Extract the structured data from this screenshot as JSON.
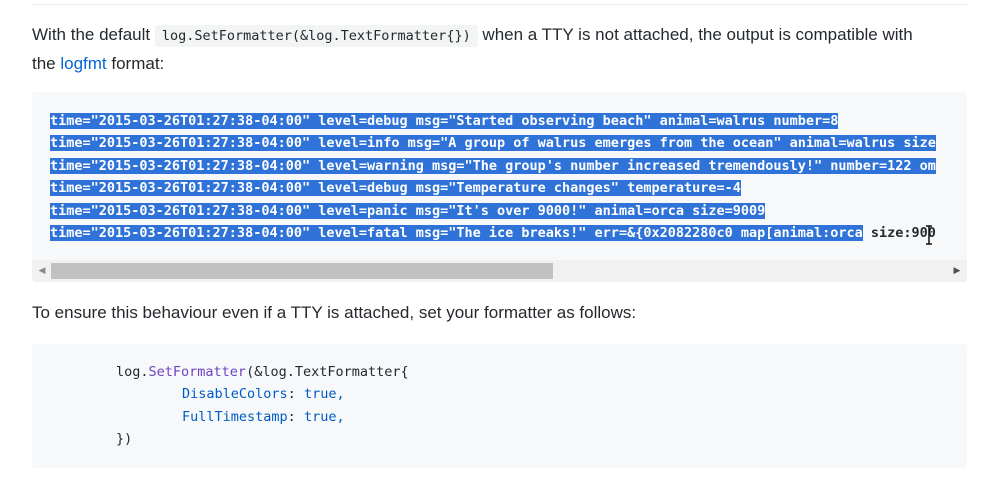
{
  "paragraph_1": {
    "before_code": "With the default ",
    "inline_code": "log.SetFormatter(&log.TextFormatter{})",
    "after_code": " when a TTY is not attached, the output is compatible with",
    "line2_before_link": "the ",
    "link_text": "logfmt",
    "line2_after_link": " format:"
  },
  "log_output": {
    "lines": [
      {
        "selected": "time=\"2015-03-26T01:27:38-04:00\" level=debug msg=\"Started observing beach\" animal=walrus number=8",
        "rest": ""
      },
      {
        "selected": "time=\"2015-03-26T01:27:38-04:00\" level=info msg=\"A group of walrus emerges from the ocean\" animal=walrus size",
        "rest": ""
      },
      {
        "selected": "time=\"2015-03-26T01:27:38-04:00\" level=warning msg=\"The group's number increased tremendously!\" number=122 om",
        "rest": ""
      },
      {
        "selected": "time=\"2015-03-26T01:27:38-04:00\" level=debug msg=\"Temperature changes\" temperature=-4",
        "rest": ""
      },
      {
        "selected": "time=\"2015-03-26T01:27:38-04:00\" level=panic msg=\"It's over 9000!\" animal=orca size=9009",
        "rest": ""
      },
      {
        "selected": "time=\"2015-03-26T01:27:38-04:00\" level=fatal msg=\"The ice breaks!\" err=&{0x2082280c0 map[animal:orca",
        "rest": " size:900"
      }
    ],
    "scrollbar": {
      "left_arrow": "◀",
      "right_arrow": "▶"
    }
  },
  "paragraph_2": {
    "text": "To ensure this behaviour even if a TTY is attached, set your formatter as follows:"
  },
  "code_example": {
    "line1_obj": "log.",
    "line1_fn": "SetFormatter",
    "line1_rest": "(&log.TextFormatter{",
    "line2_field": "DisableColors",
    "line2_colon": ":",
    "line2_value": " true,",
    "line3_field": "FullTimestamp",
    "line3_colon": ":",
    "line3_value": " true,",
    "line4": "})"
  },
  "colors": {
    "selection": "#2f73d8",
    "link": "#0366d6",
    "code_bg": "#f6f8fa"
  }
}
